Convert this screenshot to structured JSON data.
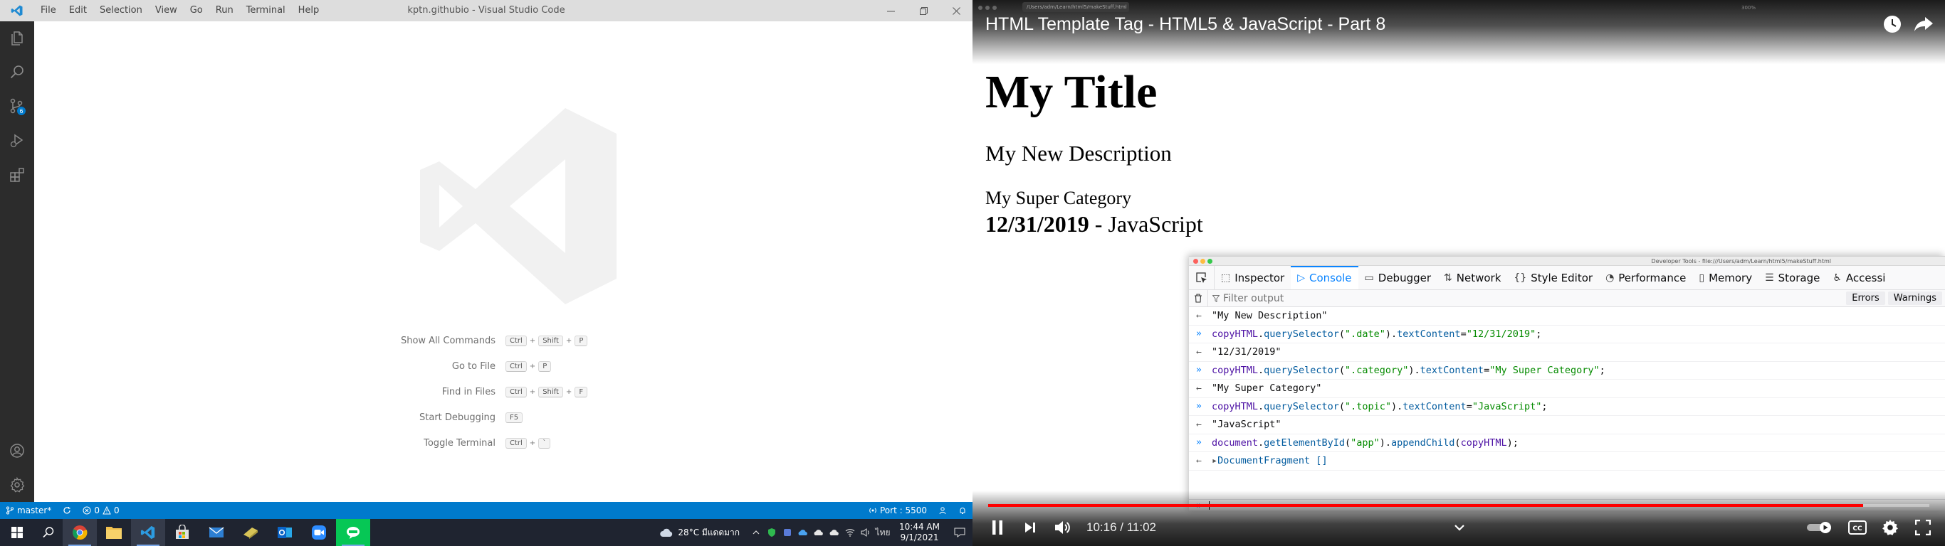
{
  "vscode": {
    "menu": [
      "File",
      "Edit",
      "Selection",
      "View",
      "Go",
      "Run",
      "Terminal",
      "Help"
    ],
    "window_title": "kptn.githubio - Visual Studio Code",
    "scm_badge": "6",
    "shortcuts": [
      {
        "label": "Show All Commands",
        "keys": [
          "Ctrl",
          "+",
          "Shift",
          "+",
          "P"
        ]
      },
      {
        "label": "Go to File",
        "keys": [
          "Ctrl",
          "+",
          "P"
        ]
      },
      {
        "label": "Find in Files",
        "keys": [
          "Ctrl",
          "+",
          "Shift",
          "+",
          "F"
        ]
      },
      {
        "label": "Start Debugging",
        "keys": [
          "F5"
        ]
      },
      {
        "label": "Toggle Terminal",
        "keys": [
          "Ctrl",
          "+",
          "`"
        ]
      }
    ],
    "status": {
      "branch": "master*",
      "errors": "0",
      "warnings": "0",
      "port": "Port : 5500"
    },
    "colors": {
      "statusbar": "#007acc",
      "activitybar": "#2c2c2c"
    }
  },
  "taskbar": {
    "weather": "28°C มีแดดมาก",
    "language": "ไทย",
    "time": "10:44 AM",
    "date": "9/1/2021"
  },
  "video": {
    "title": "HTML Template Tag - HTML5 & JavaScript - Part 8",
    "browser_tab": "/Users/adm/Learn/html5/makeStuff.html",
    "zoom": "300%",
    "page": {
      "title": "My Title",
      "description": "My New Description",
      "category": "My Super Category",
      "date": "12/31/2019",
      "separator": "-",
      "topic": "JavaScript"
    },
    "devtools": {
      "window_title": "Developer Tools - file:///Users/adm/Learn/html5/makeStuff.html",
      "tabs": [
        "Inspector",
        "Console",
        "Debugger",
        "Network",
        "Style Editor",
        "Performance",
        "Memory",
        "Storage",
        "Accessi"
      ],
      "selected_tab": "Console",
      "filter_placeholder": "Filter output",
      "filter_buttons": [
        "Errors",
        "Warnings"
      ],
      "log": [
        {
          "kind": "out",
          "text": "\"My New Description\""
        },
        {
          "kind": "in",
          "parts": [
            [
              "ident",
              "copyHTML"
            ],
            [
              "plain",
              "."
            ],
            [
              "meth",
              "querySelector"
            ],
            [
              "plain",
              "("
            ],
            [
              "str",
              "\".date\""
            ],
            [
              "plain",
              ")."
            ],
            [
              "meth",
              "textContent"
            ],
            [
              "plain",
              " = "
            ],
            [
              "str",
              "\"12/31/2019\""
            ],
            [
              "plain",
              ";"
            ]
          ]
        },
        {
          "kind": "out",
          "text": "\"12/31/2019\""
        },
        {
          "kind": "in",
          "parts": [
            [
              "ident",
              "copyHTML"
            ],
            [
              "plain",
              "."
            ],
            [
              "meth",
              "querySelector"
            ],
            [
              "plain",
              "("
            ],
            [
              "str",
              "\".category\""
            ],
            [
              "plain",
              ")."
            ],
            [
              "meth",
              "textContent"
            ],
            [
              "plain",
              " = "
            ],
            [
              "str",
              "\"My Super Category\""
            ],
            [
              "plain",
              ";"
            ]
          ]
        },
        {
          "kind": "out",
          "text": "\"My Super Category\""
        },
        {
          "kind": "in",
          "parts": [
            [
              "ident",
              "copyHTML"
            ],
            [
              "plain",
              "."
            ],
            [
              "meth",
              "querySelector"
            ],
            [
              "plain",
              "("
            ],
            [
              "str",
              "\".topic\""
            ],
            [
              "plain",
              ")."
            ],
            [
              "meth",
              "textContent"
            ],
            [
              "plain",
              " = "
            ],
            [
              "str",
              "\"JavaScript\""
            ],
            [
              "plain",
              ";"
            ]
          ]
        },
        {
          "kind": "out",
          "text": "\"JavaScript\""
        },
        {
          "kind": "in",
          "parts": [
            [
              "ident",
              "document"
            ],
            [
              "plain",
              "."
            ],
            [
              "meth",
              "getElementById"
            ],
            [
              "plain",
              "("
            ],
            [
              "str",
              "\"app\""
            ],
            [
              "plain",
              ")."
            ],
            [
              "meth",
              "appendChild"
            ],
            [
              "plain",
              "("
            ],
            [
              "ident",
              "copyHTML"
            ],
            [
              "plain",
              ");"
            ]
          ]
        },
        {
          "kind": "frag",
          "text": "DocumentFragment []"
        }
      ],
      "prompt": "»"
    },
    "player": {
      "time": "10:16 / 11:02",
      "progress": 0.9297
    }
  }
}
